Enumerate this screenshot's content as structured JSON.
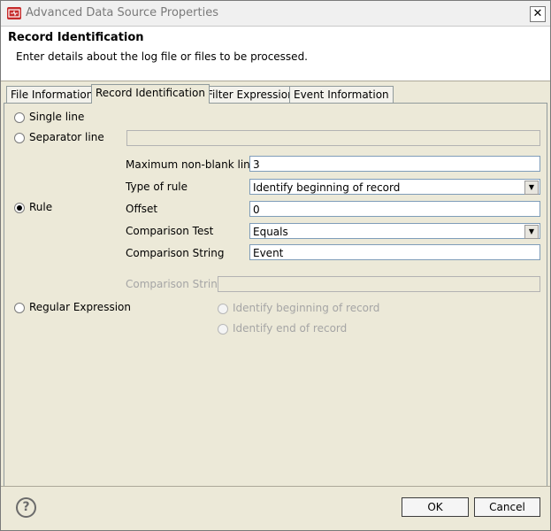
{
  "window": {
    "title": "Advanced Data Source Properties"
  },
  "header": {
    "title": "Record Identification",
    "description": "Enter details about the log file or files to be processed."
  },
  "tabs": [
    {
      "label": "File Information"
    },
    {
      "label": "Record Identification"
    },
    {
      "label": "Filter Expression"
    },
    {
      "label": "Event Information"
    }
  ],
  "options": {
    "single_line": "Single line",
    "separator_line": "Separator line",
    "rule": "Rule",
    "regular_expression": "Regular Expression"
  },
  "rule": {
    "max_lines_label": "Maximum non-blank lines",
    "max_lines_value": "3",
    "type_label": "Type of rule",
    "type_value": "Identify beginning of record",
    "offset_label": "Offset",
    "offset_value": "0",
    "test_label": "Comparison Test",
    "test_value": "Equals",
    "string_label": "Comparison String",
    "string_value": "Event"
  },
  "regex": {
    "string_label": "Comparison String",
    "begin_label": "Identify beginning of record",
    "end_label": "Identify end of record"
  },
  "footer": {
    "ok": "OK",
    "cancel": "Cancel"
  }
}
